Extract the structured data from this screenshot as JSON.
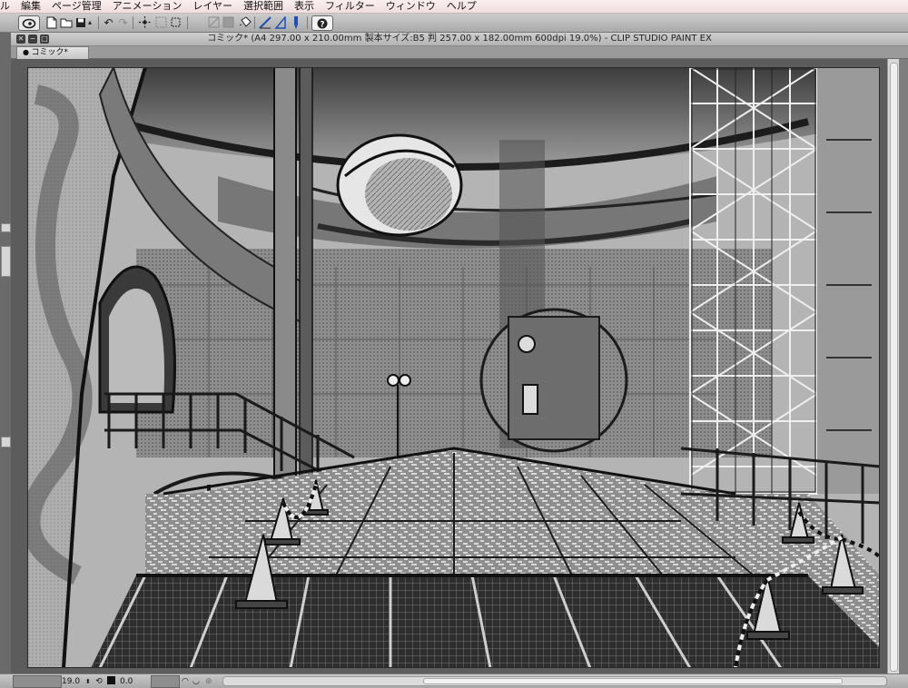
{
  "menu": {
    "items": [
      "ル",
      "編集",
      "ページ管理",
      "アニメーション",
      "レイヤー",
      "選択範囲",
      "表示",
      "フィルター",
      "ウィンドウ",
      "ヘルプ"
    ]
  },
  "toolbar": {
    "icons": [
      "clip-studio-icon",
      "new-file-icon",
      "open-file-icon",
      "save-icon",
      "undo-icon",
      "redo-icon",
      "transform-icon",
      "fit-icon",
      "clear-icon",
      "fill-icon",
      "ruler-icon",
      "pen-icon",
      "pen-tool-icon",
      "help-icon"
    ]
  },
  "window": {
    "title": "コミック* (A4 297.00 x 210.00mm 製本サイズ:B5 判 257.00 x 182.00mm 600dpi 19.0%)  - CLIP STUDIO PAINT EX",
    "tab_label": "コミック*"
  },
  "status": {
    "zoom": "19.0",
    "angle": "0.0"
  },
  "colors": {
    "menubar": "#f6e6e8",
    "toolbar": "#bdbdbd",
    "canvas_bg": "#5c5c5c",
    "accent_blue": "#1d4fb8"
  }
}
